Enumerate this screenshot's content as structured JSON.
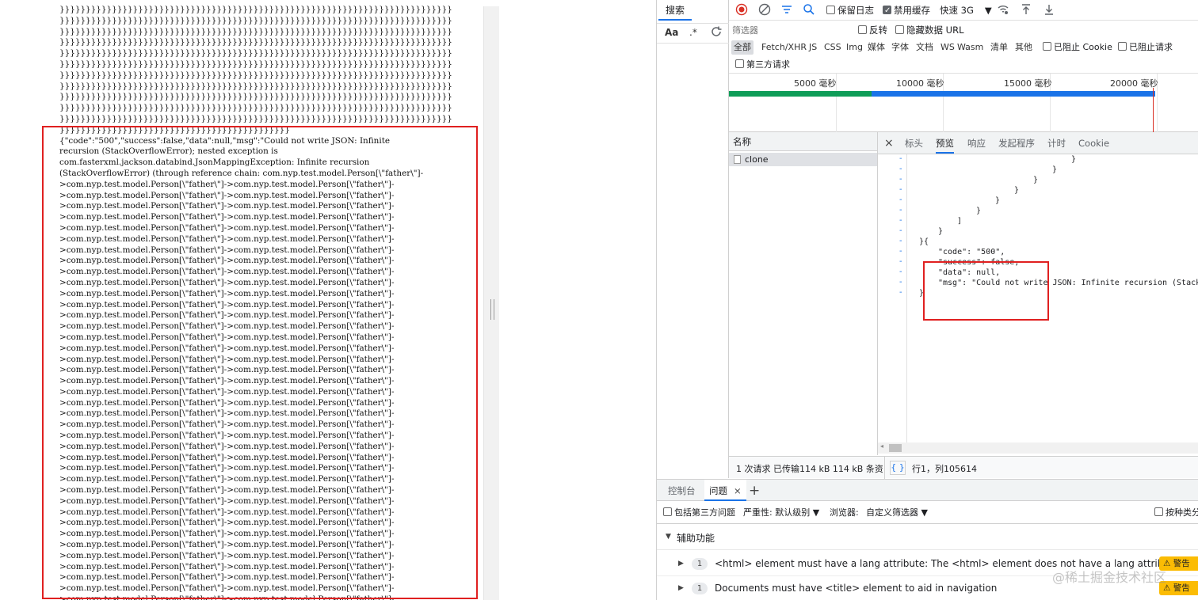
{
  "left": {
    "brace_line": "}}}}}}}}}}}}}}}}}}}}}}}}}}}}}}}}}}}}}}}}}}}}}}}}}}}}}}}}}}}}}}}}}}}}}}}}}}}",
    "brace_tail": "}}}}}}}}}}}}}}}}}}}}}}}}}}}}}}}}}}}}}}}}}}}}",
    "body_lines": [
      "{\"code\":\"500\",\"success\":false,\"data\":null,\"msg\":\"Could not write JSON: Infinite",
      "recursion (StackOverflowError); nested exception is",
      "com.fasterxml.jackson.databind.JsonMappingException: Infinite recursion",
      "(StackOverflowError) (through reference chain: com.nyp.test.model.Person[\\\"father\\\"]-"
    ],
    "repeat_line": ">com.nyp.test.model.Person[\\\"father\\\"]->com.nyp.test.model.Person[\\\"father\\\"]-"
  },
  "search": {
    "tab_label": "搜索",
    "case_label": "Aa",
    "regex_label": ".*",
    "refresh_icon": "refresh-icon"
  },
  "toolbar": {
    "preserve_log": "保留日志",
    "disable_cache": "禁用缓存",
    "throttle": "快速 3G"
  },
  "filter": {
    "placeholder": "筛选器",
    "invert": "反转",
    "hide_data_url": "隐藏数据 URL"
  },
  "types": [
    "全部",
    "Fetch/XHR",
    "JS",
    "CSS",
    "Img",
    "媒体",
    "字体",
    "文档",
    "WS",
    "Wasm",
    "清单",
    "其他"
  ],
  "blocked_cookie": "已阻止 Cookie",
  "blocked_requests": "已阻止请求",
  "third_party": "第三方请求",
  "timeline": {
    "labels": [
      "5000 毫秒",
      "10000 毫秒",
      "15000 毫秒",
      "20000 毫秒"
    ]
  },
  "requests": {
    "header": "名称",
    "rows": [
      "clone"
    ]
  },
  "detail_tabs": [
    "标头",
    "预览",
    "响应",
    "发起程序",
    "计时",
    "Cookie"
  ],
  "preview": {
    "close_symbol": "×",
    "lines": [
      {
        "indent": 34,
        "text": "}"
      },
      {
        "indent": 30,
        "text": "}"
      },
      {
        "indent": 26,
        "text": "}"
      },
      {
        "indent": 22,
        "text": "}"
      },
      {
        "indent": 18,
        "text": "}"
      },
      {
        "indent": 14,
        "text": "}"
      },
      {
        "indent": 10,
        "text": "]"
      },
      {
        "indent": 6,
        "text": "}"
      },
      {
        "indent": 2,
        "text": "}{"
      },
      {
        "indent": 6,
        "text": "\"code\": \"500\","
      },
      {
        "indent": 6,
        "text": "\"success\": false,"
      },
      {
        "indent": 6,
        "text": "\"data\": null,"
      },
      {
        "indent": 6,
        "text": "\"msg\": \"Could not write JSON: Infinite recursion (StackOv"
      },
      {
        "indent": 2,
        "text": "}"
      }
    ]
  },
  "status": {
    "summary": "1 次请求  已传输114 kB  114 kB 条资",
    "brace": "{ }",
    "position": "行1，列105614"
  },
  "drawer": {
    "tabs": [
      "控制台",
      "问题"
    ],
    "close": "×",
    "add": "+"
  },
  "issues": {
    "include_third_party": "包括第三方问题",
    "severity": "严重性: 默认级别",
    "browser": "浏览器:",
    "custom_filter": "自定义筛选器",
    "group_by": "按种类分",
    "section": "辅助功能",
    "rows": [
      {
        "count": "1",
        "text": "<html> element must have a lang attribute: The <html> element does not have a lang attribute",
        "badge": "警告"
      },
      {
        "count": "1",
        "text": "Documents must have <title> element to aid in navigation",
        "badge": "警告"
      }
    ]
  },
  "watermark": "@稀土掘金技术社区",
  "colors": {
    "highlight": "#e02020",
    "accent": "#1a73e8",
    "warning": "#fbbc04"
  }
}
